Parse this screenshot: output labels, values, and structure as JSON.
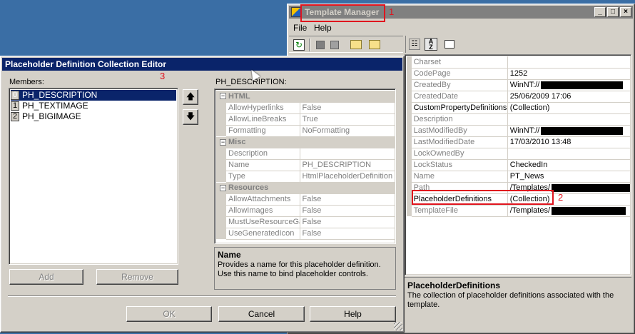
{
  "template_manager": {
    "title": "Template Manager",
    "menu": [
      "File",
      "Help"
    ],
    "properties": [
      {
        "name": "Charset",
        "value": "",
        "dim_name": true
      },
      {
        "name": "CodePage",
        "value": "1252",
        "dim_name": true
      },
      {
        "name": "CreatedBy",
        "value": "WinNT://",
        "redacted": true,
        "dim_name": true
      },
      {
        "name": "CreatedDate",
        "value": "25/06/2009 17:06",
        "dim_name": true
      },
      {
        "name": "CustomPropertyDefinitions",
        "value": "(Collection)",
        "dim_name": false
      },
      {
        "name": "Description",
        "value": "",
        "dim_name": true
      },
      {
        "name": "LastModifiedBy",
        "value": "WinNT://",
        "redacted": true,
        "dim_name": true
      },
      {
        "name": "LastModifiedDate",
        "value": "17/03/2010 13:48",
        "dim_name": true
      },
      {
        "name": "LockOwnedBy",
        "value": "",
        "dim_name": true
      },
      {
        "name": "LockStatus",
        "value": "CheckedIn",
        "dim_name": true
      },
      {
        "name": "Name",
        "value": "PT_News",
        "dim_name": true
      },
      {
        "name": "Path",
        "value": "/Templates/",
        "redacted": true,
        "dim_name": true
      },
      {
        "name": "PlaceholderDefinitions",
        "value": "(Collection)",
        "dim_name": false,
        "highlight": true
      },
      {
        "name": "TemplateFile",
        "value": "/Templates/",
        "redacted": true,
        "dim_name": true
      }
    ],
    "description": {
      "title": "PlaceholderDefinitions",
      "text": "The collection of placeholder definitions associated with the template."
    }
  },
  "collection_editor": {
    "title": "Placeholder Definition Collection Editor",
    "members_label": "Members:",
    "members": [
      {
        "index": "0",
        "name": "PH_DESCRIPTION",
        "selected": true
      },
      {
        "index": "1",
        "name": "PH_TEXTIMAGE",
        "selected": false
      },
      {
        "index": "2",
        "name": "PH_BIGIMAGE",
        "selected": false
      }
    ],
    "add_label": "Add",
    "remove_label": "Remove",
    "props_label": "PH_DESCRIPTION:",
    "categories": [
      {
        "name": "HTML",
        "rows": [
          {
            "name": "AllowHyperlinks",
            "value": "False"
          },
          {
            "name": "AllowLineBreaks",
            "value": "True"
          },
          {
            "name": "Formatting",
            "value": "NoFormatting"
          }
        ]
      },
      {
        "name": "Misc",
        "rows": [
          {
            "name": "Description",
            "value": ""
          },
          {
            "name": "Name",
            "value": "PH_DESCRIPTION"
          },
          {
            "name": "Type",
            "value": "HtmlPlaceholderDefinition"
          }
        ]
      },
      {
        "name": "Resources",
        "rows": [
          {
            "name": "AllowAttachments",
            "value": "False"
          },
          {
            "name": "AllowImages",
            "value": "False"
          },
          {
            "name": "MustUseResourceGallery",
            "value": "False"
          },
          {
            "name": "UseGeneratedIcon",
            "value": "False"
          }
        ]
      }
    ],
    "description": {
      "title": "Name",
      "text": "Provides a name for this placeholder definition. Use this name to bind placeholder controls."
    },
    "ok_label": "OK",
    "cancel_label": "Cancel",
    "help_label": "Help"
  },
  "annotations": {
    "one": "1",
    "two": "2",
    "three": "3"
  },
  "colors": {
    "annotation": "#e0141e",
    "active_title": "#0a246a",
    "desktop": "#3a6ea5"
  }
}
